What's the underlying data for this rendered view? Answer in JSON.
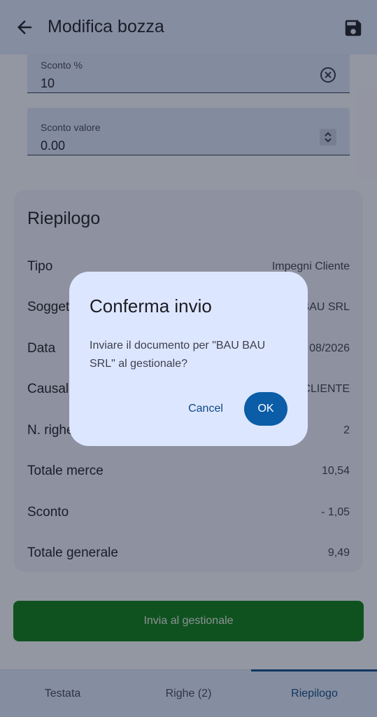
{
  "appbar": {
    "title": "Modifica bozza",
    "back_icon": "arrow-left-icon",
    "save_icon": "save-icon"
  },
  "fields": {
    "sconto_percent": {
      "label": "Sconto %",
      "value": "10",
      "trailing_icon": "clear-icon"
    },
    "sconto_valore": {
      "label": "Sconto valore",
      "value": "0.00",
      "trailing_icon": "stepper-icon"
    }
  },
  "summary": {
    "title": "Riepilogo",
    "rows": [
      {
        "label": "Tipo",
        "value": "Impegni Cliente"
      },
      {
        "label": "Soggetto",
        "value": "BAU BAU SRL"
      },
      {
        "label": "Data",
        "value": "08/2026"
      },
      {
        "label": "Causale",
        "value": "CLIENTE"
      },
      {
        "label": "N. righe",
        "value": "2"
      },
      {
        "label": "Totale merce",
        "value": "10,54"
      },
      {
        "label": "Sconto",
        "value": "- 1,05"
      },
      {
        "label": "Totale generale",
        "value": "9,49"
      }
    ]
  },
  "submit_button": {
    "label": "Invia al gestionale"
  },
  "bottom_nav": {
    "tabs": [
      {
        "label": "Testata"
      },
      {
        "label": "Righe (2)"
      },
      {
        "label": "Riepilogo"
      }
    ],
    "active": "Riepilogo"
  },
  "dialog": {
    "title": "Conferma invio",
    "body": "Inviare il documento per \"BAU BAU SRL\" al gestionale?",
    "cancel_label": "Cancel",
    "ok_label": "OK"
  },
  "colors": {
    "primary": "#0a5da6",
    "success": "#0a7d12",
    "surface": "#dde6ff"
  }
}
